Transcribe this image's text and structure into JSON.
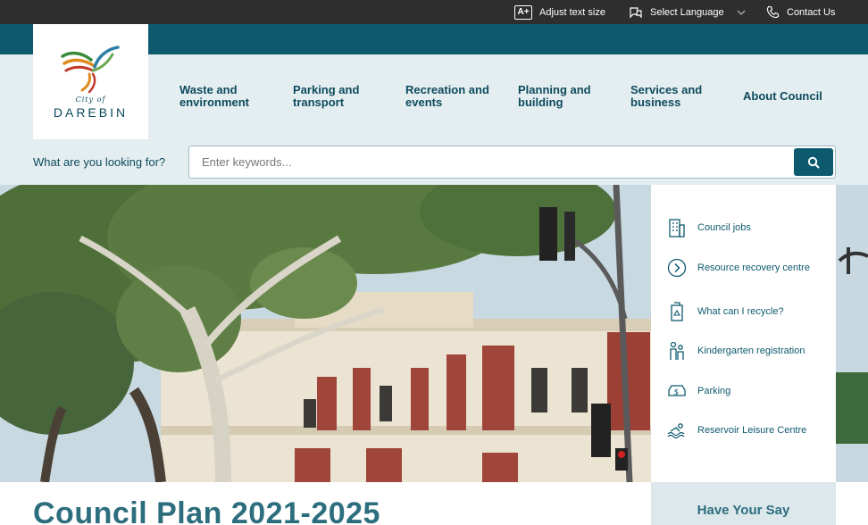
{
  "utility": {
    "text_size_icon": "A+",
    "text_size_label": "Adjust text size",
    "language_label": "Select Language",
    "contact_label": "Contact Us"
  },
  "logo": {
    "city_of": "City of",
    "name": "DAREBIN"
  },
  "nav": {
    "items": [
      {
        "label": "Waste and environment"
      },
      {
        "label": "Parking and transport"
      },
      {
        "label": "Recreation and events"
      },
      {
        "label": "Planning and building"
      },
      {
        "label": "Services and business"
      },
      {
        "label": "About Council"
      }
    ]
  },
  "search": {
    "label": "What are you looking for?",
    "placeholder": "Enter keywords...",
    "value": ""
  },
  "quick_links": [
    {
      "label": "Council jobs",
      "icon": "building-icon"
    },
    {
      "label": "Resource recovery centre",
      "icon": "chevron-circle-icon"
    },
    {
      "label": "What can I recycle?",
      "icon": "recycle-bin-icon"
    },
    {
      "label": "Kindergarten registration",
      "icon": "children-icon"
    },
    {
      "label": "Parking",
      "icon": "parking-icon"
    },
    {
      "label": "Reservoir Leisure Centre",
      "icon": "swimmer-icon"
    }
  ],
  "feature": {
    "title": "Council Plan 2021-2025"
  },
  "have_your_say": {
    "label": "Have Your Say"
  },
  "colors": {
    "utility_bar": "#2e2e2e",
    "teal": "#0d5a6e",
    "header_bg": "#e4eef1",
    "text": "#0d4a5c"
  }
}
